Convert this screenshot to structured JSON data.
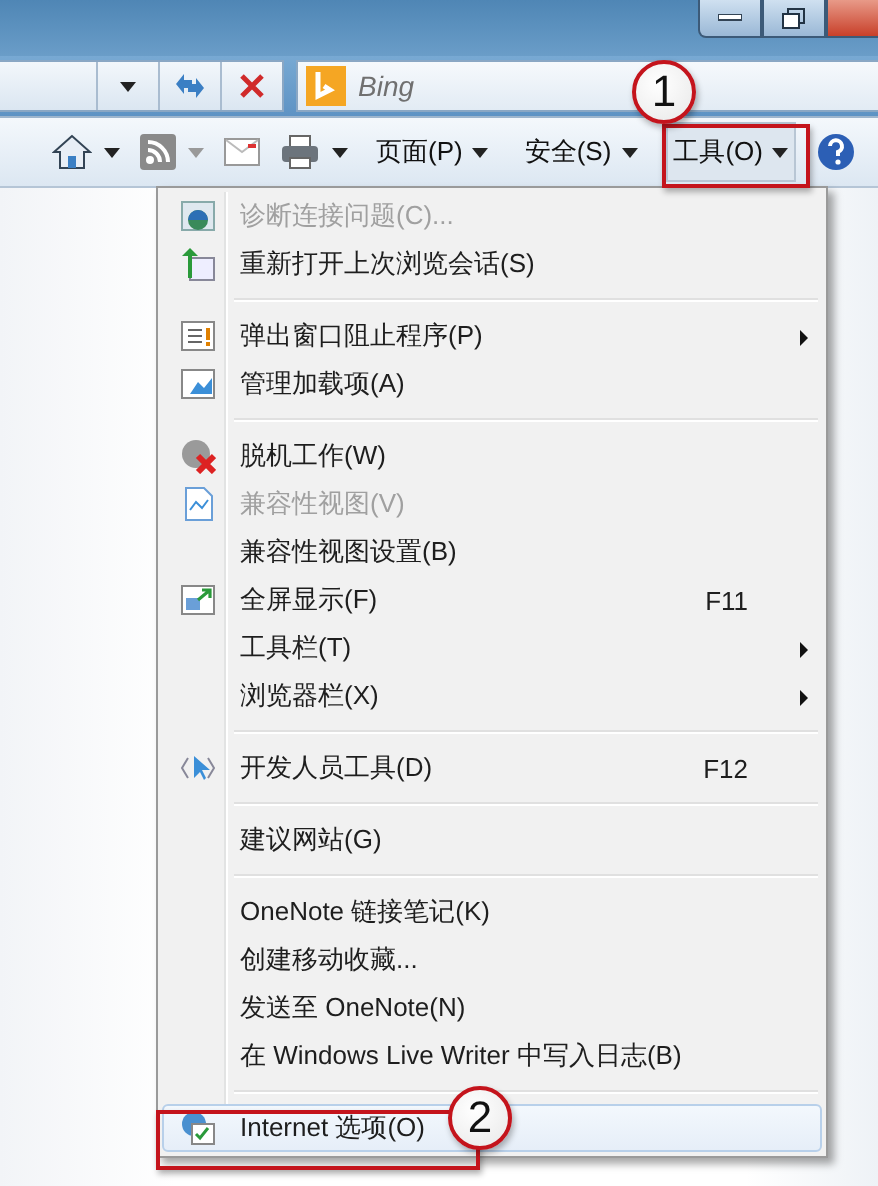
{
  "search": {
    "placeholder": "Bing"
  },
  "toolbar": [
    {
      "label": "页面(P)",
      "selected": false
    },
    {
      "label": "安全(S)",
      "selected": false
    },
    {
      "label": "工具(O)",
      "selected": true
    }
  ],
  "menu": [
    {
      "kind": "item",
      "label": "诊断连接问题(C)...",
      "disabled": true,
      "submenu": false,
      "selected": false
    },
    {
      "kind": "item",
      "label": "重新打开上次浏览会话(S)",
      "disabled": false,
      "submenu": false,
      "selected": false
    },
    {
      "kind": "separator"
    },
    {
      "kind": "item",
      "label": "弹出窗口阻止程序(P)",
      "disabled": false,
      "submenu": true,
      "selected": false
    },
    {
      "kind": "item",
      "label": "管理加载项(A)",
      "disabled": false,
      "submenu": false,
      "selected": false
    },
    {
      "kind": "separator"
    },
    {
      "kind": "item",
      "label": "脱机工作(W)",
      "disabled": false,
      "submenu": false,
      "selected": false
    },
    {
      "kind": "item",
      "label": "兼容性视图(V)",
      "disabled": true,
      "submenu": false,
      "selected": false
    },
    {
      "kind": "item",
      "label": "兼容性视图设置(B)",
      "disabled": false,
      "submenu": false,
      "selected": false
    },
    {
      "kind": "item",
      "label": "全屏显示(F)",
      "shortcut": "F11",
      "disabled": false,
      "submenu": false,
      "selected": false
    },
    {
      "kind": "item",
      "label": "工具栏(T)",
      "disabled": false,
      "submenu": true,
      "selected": false
    },
    {
      "kind": "item",
      "label": "浏览器栏(X)",
      "disabled": false,
      "submenu": true,
      "selected": false
    },
    {
      "kind": "separator"
    },
    {
      "kind": "item",
      "label": "开发人员工具(D)",
      "shortcut": "F12",
      "disabled": false,
      "submenu": false,
      "selected": false
    },
    {
      "kind": "separator"
    },
    {
      "kind": "item",
      "label": "建议网站(G)",
      "disabled": false,
      "submenu": false,
      "selected": false
    },
    {
      "kind": "separator"
    },
    {
      "kind": "item",
      "label": "OneNote 链接笔记(K)",
      "disabled": false,
      "submenu": false,
      "selected": false
    },
    {
      "kind": "item",
      "label": "创建移动收藏...",
      "disabled": false,
      "submenu": false,
      "selected": false
    },
    {
      "kind": "item",
      "label": "发送至 OneNote(N)",
      "disabled": false,
      "submenu": false,
      "selected": false
    },
    {
      "kind": "item",
      "label": "在 Windows Live Writer 中写入日志(B)",
      "disabled": false,
      "submenu": false,
      "selected": false
    },
    {
      "kind": "separator"
    },
    {
      "kind": "item",
      "label": "Internet 选项(O)",
      "disabled": false,
      "submenu": false,
      "selected": true
    }
  ],
  "callouts": [
    {
      "number": "1"
    },
    {
      "number": "2"
    }
  ]
}
